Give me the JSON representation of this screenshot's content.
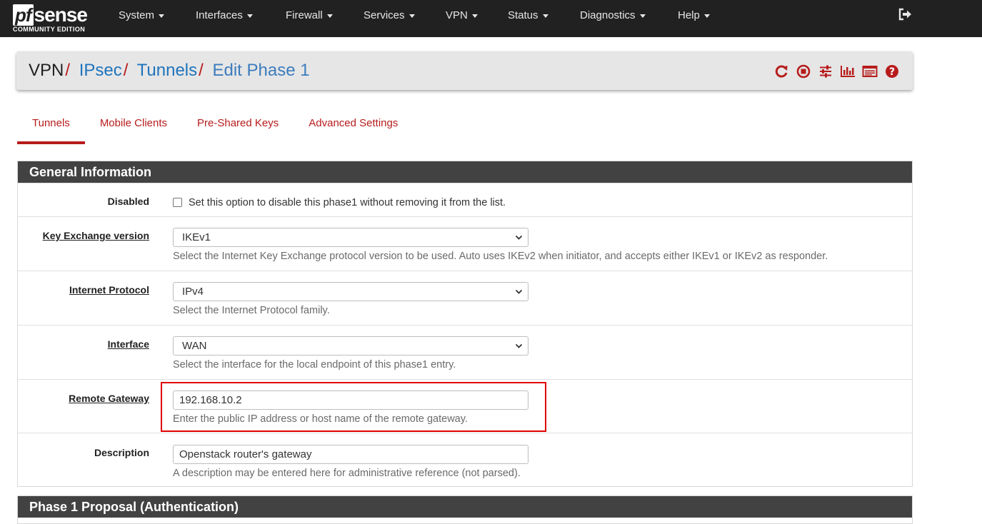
{
  "brand": {
    "logo_pf": "pf",
    "logo_sense": "sense",
    "edition": "COMMUNITY EDITION"
  },
  "nav": {
    "items": [
      {
        "label": "System"
      },
      {
        "label": "Interfaces"
      },
      {
        "label": "Firewall"
      },
      {
        "label": "Services"
      },
      {
        "label": "VPN"
      },
      {
        "label": "Status"
      },
      {
        "label": "Diagnostics"
      },
      {
        "label": "Help"
      }
    ],
    "logout_icon": "sign-out-icon"
  },
  "breadcrumb": {
    "root": "VPN",
    "separator": "/",
    "links": [
      "IPsec",
      "Tunnels",
      "Edit Phase 1"
    ],
    "toolbar_icons": [
      "restart-icon",
      "stop-icon",
      "settings-sliders-icon",
      "bar-chart-icon",
      "log-list-icon",
      "help-icon"
    ]
  },
  "tabs": [
    "Tunnels",
    "Mobile Clients",
    "Pre-Shared Keys",
    "Advanced Settings"
  ],
  "active_tab": "Tunnels",
  "general": {
    "heading": "General Information",
    "disabled": {
      "label": "Disabled",
      "checkbox_text": "Set this option to disable this phase1 without removing it from the list.",
      "checked": false
    },
    "key_exchange": {
      "label": "Key Exchange version",
      "value": "IKEv1",
      "help": "Select the Internet Key Exchange protocol version to be used. Auto uses IKEv2 when initiator, and accepts either IKEv1 or IKEv2 as responder."
    },
    "internet_protocol": {
      "label": "Internet Protocol",
      "value": "IPv4",
      "help": "Select the Internet Protocol family."
    },
    "interface": {
      "label": "Interface",
      "value": "WAN",
      "help": "Select the interface for the local endpoint of this phase1 entry."
    },
    "remote_gateway": {
      "label": "Remote Gateway",
      "value": "192.168.10.2",
      "help": "Enter the public IP address or host name of the remote gateway."
    },
    "description": {
      "label": "Description",
      "value": "Openstack router's gateway",
      "help": "A description may be entered here for administrative reference (not parsed)."
    }
  },
  "phase1": {
    "heading": "Phase 1 Proposal (Authentication)"
  },
  "colors": {
    "navbar": "#212121",
    "accent_red": "#b71c1c",
    "link_blue": "#1e74bd",
    "panel_heading": "#424242",
    "highlight_box": "#e00000"
  }
}
